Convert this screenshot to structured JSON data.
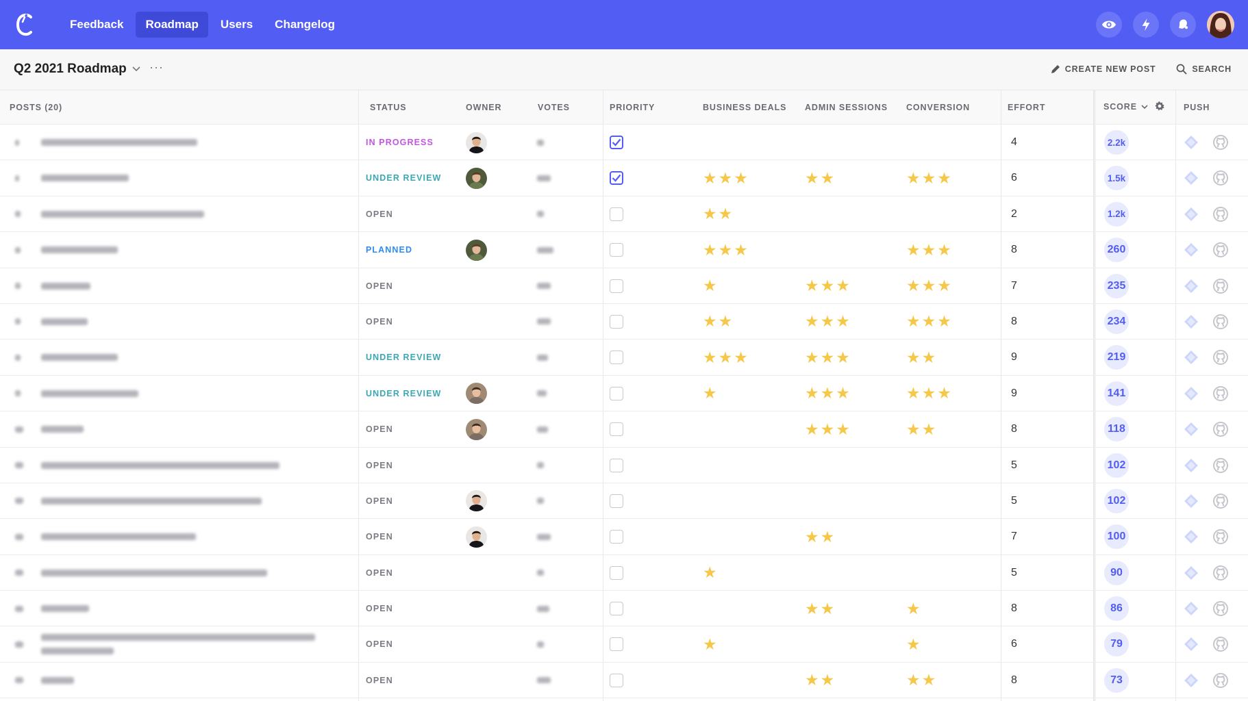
{
  "nav": {
    "items": [
      {
        "label": "Feedback",
        "active": false
      },
      {
        "label": "Roadmap",
        "active": true
      },
      {
        "label": "Users",
        "active": false
      },
      {
        "label": "Changelog",
        "active": false
      }
    ]
  },
  "board": {
    "title": "Q2 2021 Roadmap",
    "more": "···",
    "create_label": "CREATE NEW POST",
    "search_label": "SEARCH"
  },
  "columns": {
    "posts": "POSTS (20)",
    "status": "STATUS",
    "owner": "OWNER",
    "votes": "VOTES",
    "priority": "PRIORITY",
    "business_deals": "BUSINESS DEALS",
    "admin_sessions": "ADMIN SESSIONS",
    "conversion": "CONVERSION",
    "effort": "EFFORT",
    "score": "SCORE",
    "push": "PUSH"
  },
  "colors": {
    "accent": "#525df4",
    "in_progress": "#c355e4",
    "under_review": "#3aa8b5",
    "planned": "#2c8cf2",
    "open": "#7b7b84",
    "star": "#f6c84a",
    "push_diamond": "#cdd5fb",
    "push_github": "#c5c5cc"
  },
  "rows": [
    {
      "status": "IN PROGRESS",
      "status_key": "in_progress",
      "owner": "avatar-a",
      "priority": true,
      "business": 0,
      "admin": 0,
      "conversion": 0,
      "effort": "4",
      "score": "2.2k"
    },
    {
      "status": "UNDER REVIEW",
      "status_key": "under_review",
      "owner": "avatar-b",
      "priority": true,
      "business": 3,
      "admin": 2,
      "conversion": 3,
      "effort": "6",
      "score": "1.5k"
    },
    {
      "status": "OPEN",
      "status_key": "open",
      "owner": "",
      "priority": false,
      "business": 2,
      "admin": 0,
      "conversion": 0,
      "effort": "2",
      "score": "1.2k"
    },
    {
      "status": "PLANNED",
      "status_key": "planned",
      "owner": "avatar-b",
      "priority": false,
      "business": 3,
      "admin": 0,
      "conversion": 3,
      "effort": "8",
      "score": "260"
    },
    {
      "status": "OPEN",
      "status_key": "open",
      "owner": "",
      "priority": false,
      "business": 1,
      "admin": 3,
      "conversion": 3,
      "effort": "7",
      "score": "235"
    },
    {
      "status": "OPEN",
      "status_key": "open",
      "owner": "",
      "priority": false,
      "business": 2,
      "admin": 3,
      "conversion": 3,
      "effort": "8",
      "score": "234"
    },
    {
      "status": "UNDER REVIEW",
      "status_key": "under_review",
      "owner": "",
      "priority": false,
      "business": 3,
      "admin": 3,
      "conversion": 2,
      "effort": "9",
      "score": "219"
    },
    {
      "status": "UNDER REVIEW",
      "status_key": "under_review",
      "owner": "avatar-c",
      "priority": false,
      "business": 1,
      "admin": 3,
      "conversion": 3,
      "effort": "9",
      "score": "141"
    },
    {
      "status": "OPEN",
      "status_key": "open",
      "owner": "avatar-c",
      "priority": false,
      "business": 0,
      "admin": 3,
      "conversion": 2,
      "effort": "8",
      "score": "118"
    },
    {
      "status": "OPEN",
      "status_key": "open",
      "owner": "",
      "priority": false,
      "business": 0,
      "admin": 0,
      "conversion": 0,
      "effort": "5",
      "score": "102"
    },
    {
      "status": "OPEN",
      "status_key": "open",
      "owner": "avatar-a",
      "priority": false,
      "business": 0,
      "admin": 0,
      "conversion": 0,
      "effort": "5",
      "score": "102"
    },
    {
      "status": "OPEN",
      "status_key": "open",
      "owner": "avatar-a",
      "priority": false,
      "business": 0,
      "admin": 2,
      "conversion": 0,
      "effort": "7",
      "score": "100"
    },
    {
      "status": "OPEN",
      "status_key": "open",
      "owner": "",
      "priority": false,
      "business": 1,
      "admin": 0,
      "conversion": 0,
      "effort": "5",
      "score": "90"
    },
    {
      "status": "OPEN",
      "status_key": "open",
      "owner": "",
      "priority": false,
      "business": 0,
      "admin": 2,
      "conversion": 1,
      "effort": "8",
      "score": "86"
    },
    {
      "status": "OPEN",
      "status_key": "open",
      "owner": "",
      "priority": false,
      "business": 1,
      "admin": 0,
      "conversion": 1,
      "effort": "6",
      "score": "79"
    },
    {
      "status": "OPEN",
      "status_key": "open",
      "owner": "",
      "priority": false,
      "business": 0,
      "admin": 2,
      "conversion": 2,
      "effort": "8",
      "score": "73"
    }
  ]
}
